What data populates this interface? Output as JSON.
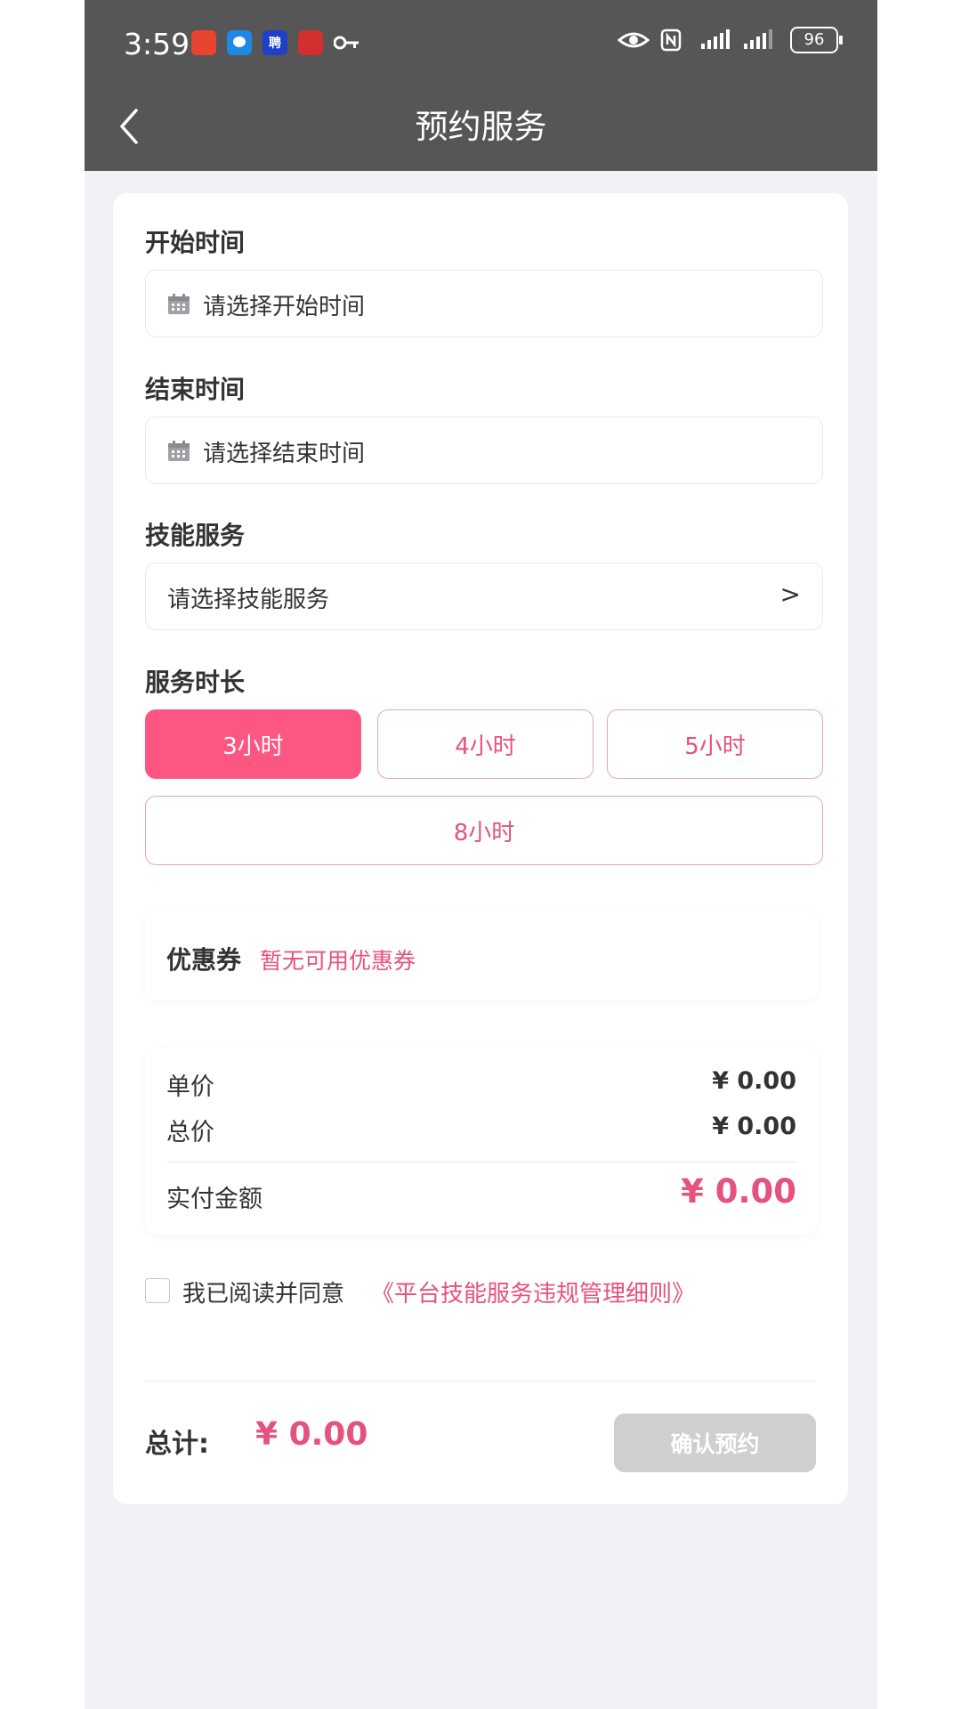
{
  "status_bar": {
    "time": "3:59",
    "battery": "96",
    "apps": [
      {
        "icon": "app-icon-red",
        "color": "#e8442f"
      },
      {
        "icon": "app-icon-chat",
        "color": "#1e88e5"
      },
      {
        "icon": "app-icon-recruit",
        "color": "#1e40c8",
        "label": "聘"
      },
      {
        "icon": "app-icon-news",
        "color": "#d32f2f"
      }
    ]
  },
  "header": {
    "title": "预约服务"
  },
  "form": {
    "start_label": "开始时间",
    "start_placeholder": "请选择开始时间",
    "end_label": "结束时间",
    "end_placeholder": "请选择结束时间",
    "skill_label": "技能服务",
    "skill_placeholder": "请选择技能服务",
    "skill_chevron": ">",
    "duration_label": "服务时长",
    "durations": [
      {
        "label": "3小时",
        "selected": true
      },
      {
        "label": "4小时",
        "selected": false
      },
      {
        "label": "5小时",
        "selected": false
      },
      {
        "label": "8小时",
        "selected": false
      }
    ]
  },
  "coupon": {
    "label": "优惠券",
    "value": "暂无可用优惠券"
  },
  "pricing": {
    "unit_label": "单价",
    "unit_value": "¥ 0.00",
    "total_label": "总价",
    "total_value": "¥ 0.00",
    "paid_label": "实付金额",
    "paid_value": "¥ 0.00"
  },
  "agreement": {
    "text": "我已阅读并同意",
    "link": "《平台技能服务违规管理细则》",
    "checked": false
  },
  "footer": {
    "total_label": "总计:",
    "total_value": "¥ 0.00",
    "confirm_label": "确认预约"
  },
  "colors": {
    "accent": "#fc5683",
    "accent_text": "#e5527d",
    "header_bg": "#565656",
    "disabled": "#cfcfcf"
  }
}
